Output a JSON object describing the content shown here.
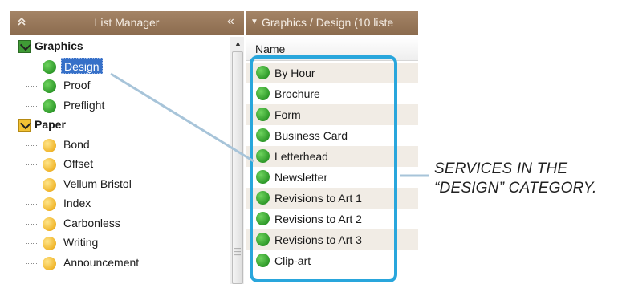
{
  "left_panel": {
    "title": "List Manager",
    "collapse_up_glyph": "»",
    "collapse_left_glyph": "«",
    "tree": [
      {
        "type": "category",
        "label": "Graphics",
        "icon": "green-category-icon",
        "color": "#3f9b35"
      },
      {
        "type": "leaf",
        "label": "Design",
        "status": "green",
        "selected": true
      },
      {
        "type": "leaf",
        "label": "Proof",
        "status": "green"
      },
      {
        "type": "leaf",
        "label": "Preflight",
        "status": "green"
      },
      {
        "type": "category",
        "label": "Paper",
        "icon": "yellow-category-icon",
        "color": "#f2c235"
      },
      {
        "type": "leaf",
        "label": "Bond",
        "status": "yellow"
      },
      {
        "type": "leaf",
        "label": "Offset",
        "status": "yellow"
      },
      {
        "type": "leaf",
        "label": "Vellum Bristol",
        "status": "yellow"
      },
      {
        "type": "leaf",
        "label": "Index",
        "status": "yellow"
      },
      {
        "type": "leaf",
        "label": "Carbonless",
        "status": "yellow"
      },
      {
        "type": "leaf",
        "label": "Writing",
        "status": "yellow"
      },
      {
        "type": "leaf",
        "label": "Announcement",
        "status": "yellow"
      }
    ]
  },
  "right_panel": {
    "breadcrumb": "Graphics / Design (10 liste",
    "column_header": "Name",
    "items": [
      "By Hour",
      "Brochure",
      "Form",
      "Business Card",
      "Letterhead",
      "Newsletter",
      "Revisions to Art 1",
      "Revisions to Art 2",
      "Revisions to Art 3",
      "Clip-art"
    ]
  },
  "caption": {
    "line1": "SERVICES IN THE",
    "line2": "“DESIGN” CATEGORY."
  },
  "colors": {
    "header_brown": "#8b6b4e",
    "highlight_blue": "#29a6dc",
    "selection_blue": "#3670c8"
  }
}
